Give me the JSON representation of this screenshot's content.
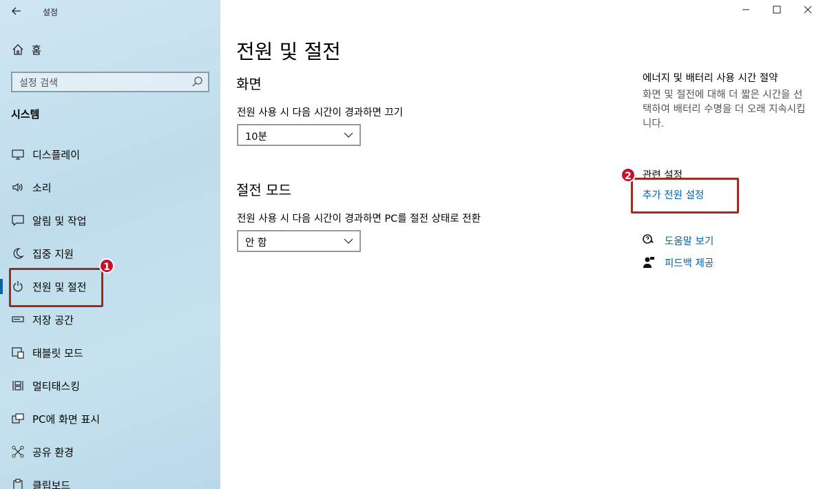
{
  "window": {
    "title": "설정",
    "controls": [
      "minimize",
      "maximize",
      "close"
    ]
  },
  "sidebar": {
    "home_label": "홈",
    "search_placeholder": "설정 검색",
    "section": "시스템",
    "items": [
      {
        "label": "디스플레이",
        "icon": "monitor-icon"
      },
      {
        "label": "소리",
        "icon": "speaker-icon"
      },
      {
        "label": "알림 및 작업",
        "icon": "notification-icon"
      },
      {
        "label": "집중 지원",
        "icon": "moon-icon"
      },
      {
        "label": "전원 및 절전",
        "icon": "power-icon",
        "selected": true
      },
      {
        "label": "저장 공간",
        "icon": "storage-icon"
      },
      {
        "label": "태블릿 모드",
        "icon": "tablet-icon"
      },
      {
        "label": "멀티태스킹",
        "icon": "multitask-icon"
      },
      {
        "label": "PC에 화면 표시",
        "icon": "project-icon"
      },
      {
        "label": "공유 환경",
        "icon": "share-icon"
      },
      {
        "label": "클립보드",
        "icon": "clipboard-icon"
      }
    ]
  },
  "main": {
    "title": "전원 및 절전",
    "screen": {
      "heading": "화면",
      "label": "전원 사용 시 다음 시간이 경과하면 끄기",
      "value": "10분"
    },
    "sleep": {
      "heading": "절전 모드",
      "label": "전원 사용 시 다음 시간이 경과하면 PC를 절전 상태로 전환",
      "value": "안 함"
    }
  },
  "right": {
    "tip_title": "에너지 및 배터리 사용 시간 절약",
    "tip_desc": "화면 및 절전에 대해 더 짧은 시간을 선택하여 배터리 수명을 더 오래 지속시킵니다.",
    "related_title": "관련 설정",
    "related_link": "추가 전원 설정",
    "help_link": "도움말 보기",
    "feedback_link": "피드백 제공"
  },
  "annotations": {
    "badge1": "1",
    "badge2": "2"
  },
  "colors": {
    "accent": "#0063b1",
    "highlight_box": "#9b2d20",
    "badge": "#c8102e"
  }
}
